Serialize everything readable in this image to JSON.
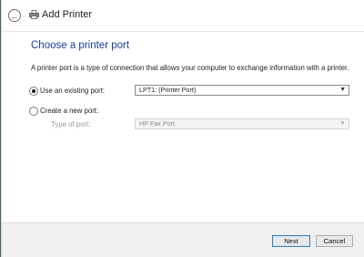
{
  "window": {
    "title": "Add Printer"
  },
  "main": {
    "heading": "Choose a printer port",
    "description": "A printer port is a type of connection that allows your computer to exchange information with a printer."
  },
  "options": {
    "existing": {
      "label": "Use an existing port:",
      "selected": true,
      "value": "LPT1: (Printer Port)"
    },
    "create_new": {
      "label": "Create a new port:",
      "selected": false,
      "type_label": "Type of port:",
      "type_value": "HP Fax Port"
    }
  },
  "footer": {
    "next_label": "Next",
    "cancel_label": "Cancel"
  },
  "icons": {
    "back": "back-arrow-icon",
    "printer": "printer-icon",
    "dropdown": "chevron-down-icon"
  },
  "colors": {
    "heading": "#1a3d8f",
    "footer_bg": "#f0f0f0",
    "primary_border": "#3c7fb1"
  }
}
